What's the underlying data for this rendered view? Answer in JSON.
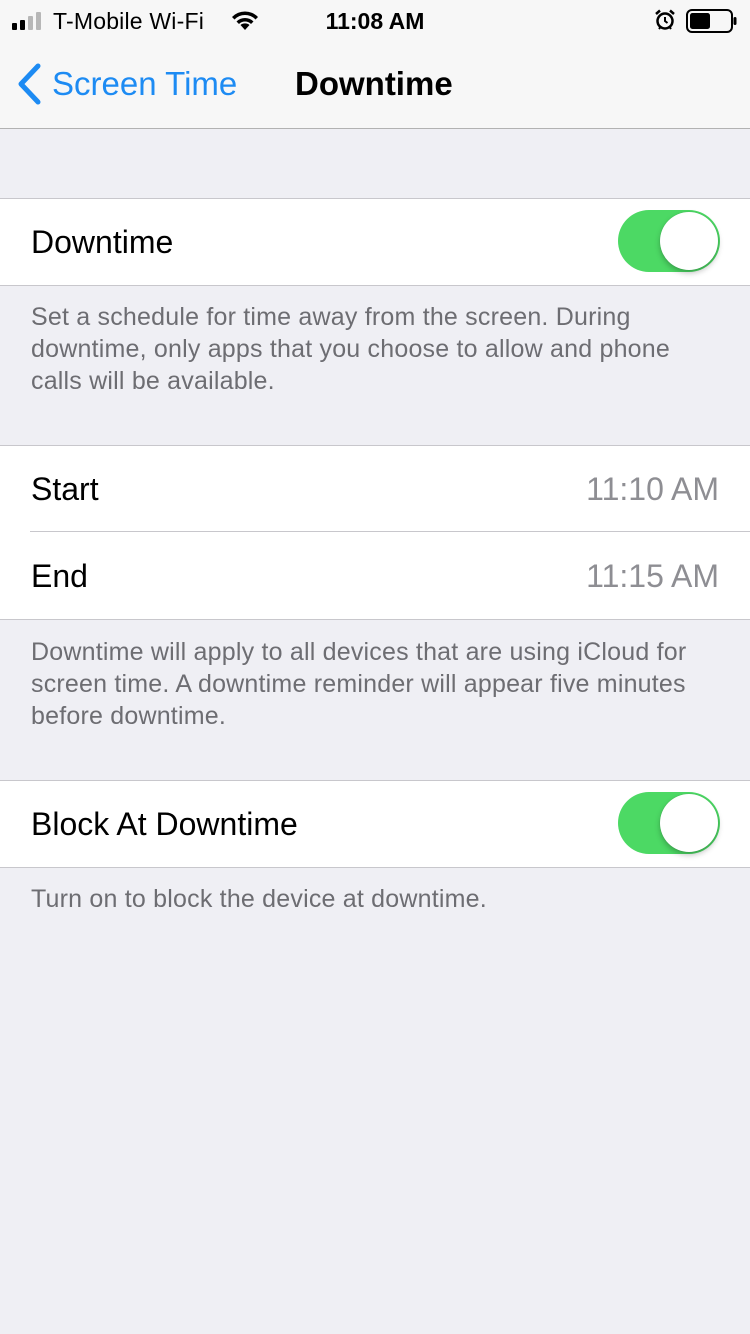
{
  "status_bar": {
    "carrier": "T-Mobile Wi-Fi",
    "time": "11:08 AM",
    "icons": [
      "signal-icon",
      "wifi-icon",
      "alarm-icon",
      "battery-icon"
    ],
    "battery_level": 0.5
  },
  "nav": {
    "back_label": "Screen Time",
    "title": "Downtime",
    "accent_color": "#1d8bf3"
  },
  "downtime_section": {
    "label": "Downtime",
    "enabled": true,
    "footer": "Set a schedule for time away from the screen. During downtime, only apps that you choose to allow and phone calls will be available."
  },
  "schedule_section": {
    "rows": [
      {
        "label": "Start",
        "value": "11:10 AM"
      },
      {
        "label": "End",
        "value": "11:15 AM"
      }
    ],
    "footer": "Downtime will apply to all devices that are using iCloud for screen time. A downtime reminder will appear five minutes before downtime."
  },
  "block_section": {
    "label": "Block At Downtime",
    "enabled": true,
    "footer": "Turn on to block the device at downtime."
  },
  "colors": {
    "toggle_on": "#4cd964",
    "background": "#efeff4",
    "secondary_text": "#8e8e93"
  }
}
